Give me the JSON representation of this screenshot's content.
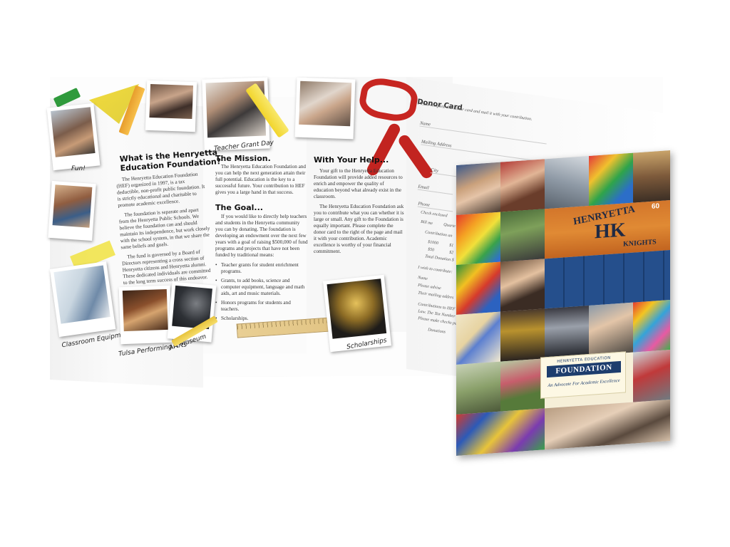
{
  "brochure": {
    "captions": {
      "fun": "Fun!",
      "classroom": "Classroom Equipment",
      "performing": "Tulsa Performing Arts",
      "art": "Art Museum",
      "teacher": "Teacher Grant Day",
      "scholarships": "Scholarships"
    },
    "what_is": {
      "heading_1": "What is the Henryetta",
      "heading_2": "Education Foundation?",
      "paragraphs": [
        "The Henryetta Education Foundation (HEF) organized in 1997, is a tax deductible, non-profit public foundation. It is strictly educational and charitable to promote academic excellence.",
        "The foundation is separate and apart from the Henryetta Public Schools. We believe the foundation can and should maintain its independence, but work closely with the school system, in that we share the same beliefs and goals.",
        "The fund is governed by a Board of Directors representing a cross section of Henryetta citizens and Henryetta alumni. These dedicated individuals are committed to the long term success of this endeavor."
      ]
    },
    "mission": {
      "heading": "The Mission.",
      "text": "The Henryetta Education Foundation and you can help the next generation attain their full potential. Education is the key to a successful future. Your contribution to HEF gives you a large hand in that success."
    },
    "goal": {
      "heading": "The Goal...",
      "text": "If you would like to directly help teachers and students in the Henryetta community you can by donating. The foundation is developing an endowment over the next few years with a goal of raising $500,000 of fund programs and projects that have not been funded by traditional means:",
      "bullets": [
        "Teacher grants for student enrichment programs.",
        "Grants, to add books, science and computer equipment, language and math aids, art and music materials.",
        "Honors programs for students and teachers.",
        "Scholarships."
      ]
    },
    "help": {
      "heading": "With Your Help...",
      "paragraphs": [
        "Your gift to the Henryetta Education Foundation will provide added resources to enrich and empower the quality of education beyond what already exist in the classroom.",
        "The Henryetta Education Foundation ask you to contribute what you can whether it is large or small. Any gift to the Foundation is equally important. Please complete the donor card to the right of the page and mail it with your contribution. Academic excellence is worthy of your financial commitment."
      ]
    },
    "donor": {
      "title": "Donor Card",
      "subtitle": "Please complete this donor card and mail it with your contribution.",
      "fields": [
        "Name",
        "Mailing Address",
        "City",
        "Email",
        "Phone"
      ],
      "options": [
        "Check enclosed",
        "Bill me",
        "Quarte",
        "Contribution an",
        "$1000",
        "$1",
        "$50",
        "$2",
        "Total Donation $",
        "I wish to contribute:",
        "Name",
        "Please advise",
        "Their mailing addres",
        "Contributions to HEF",
        "Law. The Tax Number",
        "Please make checks pa",
        "Donations"
      ]
    }
  },
  "cover": {
    "logo_small": "HENRYETTA EDUCATION",
    "logo_big": "FOUNDATION",
    "tagline": "An Advocate For Academic Excellence",
    "jersey_text": "HENRYETTA",
    "jersey_letters": "HK",
    "jersey_sub": "KNIGHTS",
    "jersey_number": "60"
  }
}
